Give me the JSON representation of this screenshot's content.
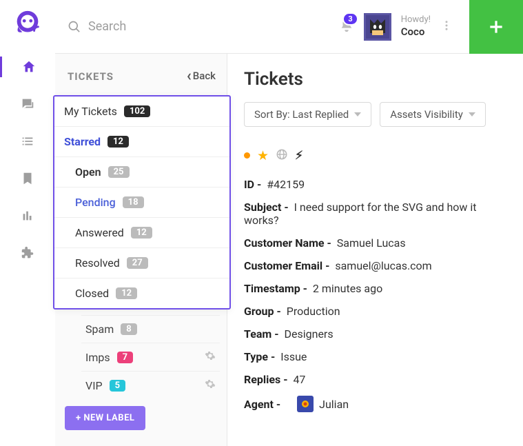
{
  "topbar": {
    "search_placeholder": "Search",
    "notification_count": "3",
    "greeting": "Howdy!",
    "username": "Coco"
  },
  "sidebar": {
    "title": "TICKETS",
    "back_label": "Back",
    "new_label_button": "+ NEW LABEL",
    "labels": [
      {
        "name": "Spam",
        "count": "8",
        "badge_color": "gray",
        "gear": false
      },
      {
        "name": "Imps",
        "count": "7",
        "badge_color": "pink",
        "gear": true
      },
      {
        "name": "VIP",
        "count": "5",
        "badge_color": "teal",
        "gear": true
      }
    ]
  },
  "dropdown": {
    "items": [
      {
        "name": "My Tickets",
        "count": "102",
        "badge": "dark",
        "cls": ""
      },
      {
        "name": "Starred",
        "count": "12",
        "badge": "dark",
        "cls": "starred"
      },
      {
        "name": "Open",
        "count": "25",
        "badge": "gray",
        "cls": "sub"
      },
      {
        "name": "Pending",
        "count": "18",
        "badge": "gray",
        "cls": "sub pending"
      },
      {
        "name": "Answered",
        "count": "12",
        "badge": "gray",
        "cls": "sub"
      },
      {
        "name": "Resolved",
        "count": "27",
        "badge": "gray",
        "cls": "sub"
      },
      {
        "name": "Closed",
        "count": "12",
        "badge": "gray",
        "cls": "sub"
      }
    ]
  },
  "details": {
    "heading": "Tickets",
    "sort_label": "Sort By: Last Replied",
    "assets_label": "Assets Visibility",
    "fields": {
      "id_label": "ID -",
      "id_value": "#42159",
      "subject_label": "Subject -",
      "subject_value": "I need support for the SVG and how it works?",
      "customer_name_label": "Customer Name -",
      "customer_name_value": "Samuel Lucas",
      "customer_email_label": "Customer Email -",
      "customer_email_value": "samuel@lucas.com",
      "timestamp_label": "Timestamp -",
      "timestamp_value": "2 minutes ago",
      "group_label": "Group -",
      "group_value": "Production",
      "team_label": "Team -",
      "team_value": "Designers",
      "type_label": "Type -",
      "type_value": "Issue",
      "replies_label": "Replies -",
      "replies_value": "47",
      "agent_label": "Agent -",
      "agent_value": "Julian"
    }
  }
}
